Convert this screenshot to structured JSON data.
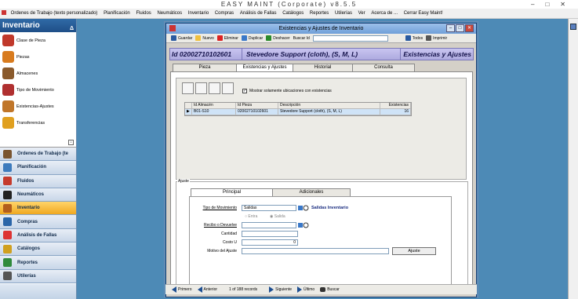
{
  "app": {
    "title": "EASY MAINT (Corporate) v8.5.5",
    "window_buttons": [
      "–",
      "□",
      "✕"
    ]
  },
  "menu": [
    "Ordenes de Trabajo (texto personalizado)",
    "Planificación",
    "Fluidos",
    "Neumáticos",
    "Inventario",
    "Compras",
    "Análisis de Fallas",
    "Catálogos",
    "Reportes",
    "Utilerías",
    "Ver",
    "Acerca de ...",
    "Cerrar Easy Maint!"
  ],
  "sidebar": {
    "title": "Inventario",
    "pin": "Δ",
    "items": [
      {
        "label": "Clase de Pieza",
        "icon": "pencil-icon",
        "color": "#c0392b"
      },
      {
        "label": "Piezas",
        "icon": "gear-icon",
        "color": "#d87b1e"
      },
      {
        "label": "Almacenes",
        "icon": "warehouse-icon",
        "color": "#8a5a2c"
      },
      {
        "label": "Tipo de Movimiento",
        "icon": "cards-icon",
        "color": "#b03030"
      },
      {
        "label": "Existencias-Ajustes",
        "icon": "boxes-icon",
        "color": "#c0762a"
      },
      {
        "label": "Transferencias",
        "icon": "transfer-icon",
        "color": "#e0a020"
      }
    ],
    "scroll_label": "↓",
    "nav": [
      {
        "label": "Ordenes de Trabajo (te",
        "icon": "clipboard-icon",
        "color": "#7a5530"
      },
      {
        "label": "Planificación",
        "icon": "calendar-icon",
        "color": "#3d7bbd"
      },
      {
        "label": "Fluidos",
        "icon": "fluid-icon",
        "color": "#c53a2c"
      },
      {
        "label": "Neumáticos",
        "icon": "tire-icon",
        "color": "#222"
      },
      {
        "label": "Inventario",
        "icon": "inventory-icon",
        "color": "#b35e1c",
        "active": true
      },
      {
        "label": "Compras",
        "icon": "cart-icon",
        "color": "#2a65a8"
      },
      {
        "label": "Análisis de Fallas",
        "icon": "warning-icon",
        "color": "#d33"
      },
      {
        "label": "Catálogos",
        "icon": "catalog-icon",
        "color": "#d0a020"
      },
      {
        "label": "Reportes",
        "icon": "report-icon",
        "color": "#2f8a3c"
      },
      {
        "label": "Utilerías",
        "icon": "tools-icon",
        "color": "#555"
      }
    ]
  },
  "window": {
    "title": "Existencias y Ajustes de Inventario",
    "toolbar": [
      {
        "label": "Guardar",
        "icon": "save-icon",
        "color": "#2a5aa0"
      },
      {
        "label": "Nuevo",
        "icon": "new-icon",
        "color": "#f0c040"
      },
      {
        "label": "Eliminar",
        "icon": "delete-icon",
        "color": "#d22"
      },
      {
        "label": "Duplicar",
        "icon": "duplicate-icon",
        "color": "#3a78c8"
      },
      {
        "label": "Deshacer",
        "icon": "undo-icon",
        "color": "#2a8a2a"
      },
      {
        "label": "Buscar Id",
        "icon": "",
        "color": ""
      }
    ],
    "toolbar_right": [
      {
        "label": "Todos",
        "icon": "list-icon",
        "color": "#2a5aa0"
      },
      {
        "label": "Imprimir",
        "icon": "print-icon",
        "color": "#555"
      }
    ],
    "header": {
      "id": "Id  02002710102601",
      "name": "Stevedore Support (cloth), (S, M, L)",
      "section": "Existencias y Ajustes"
    },
    "tabs": [
      {
        "label": "Pieza",
        "w": 82
      },
      {
        "label": "Existencias y Ajustes",
        "w": 73,
        "selected": true
      },
      {
        "label": "Historial",
        "w": 77
      },
      {
        "label": "Consulta",
        "w": 80
      }
    ],
    "filter_label": "Mostrar solamente ubicaciones con existencias",
    "filter_checked": "✓",
    "grid": {
      "headers": [
        "",
        "Id Almacén",
        "Id Pieza",
        "Descripción",
        "Existencias"
      ],
      "rows": [
        [
          "▶",
          "B01-S10",
          "02002710102601",
          "Stevedore Support (cloth), (S, M, L)",
          "16"
        ]
      ]
    },
    "ajuste": {
      "label": "Ajuste",
      "tabs": [
        "Principal",
        "Adicionales"
      ],
      "fields": {
        "tipo_label": "Tipo de Movimiento",
        "tipo_value": "Salidas",
        "tipo_desc": "Salidas Inventario",
        "radio_a": "Entra",
        "radio_b": "Salida",
        "recibo_label": "Recibo o Devuelve",
        "cantidad_label": "Cantidad",
        "costo_label": "Costo U",
        "costo_value": "0",
        "motivo_label": "Motivo del Ajuste",
        "button": "Ajuste"
      }
    },
    "nav": {
      "first": "Primero",
      "prev": "Anterior",
      "records": "1 of 188 records",
      "next": "Siguiente",
      "last": "Último",
      "search": "Buscar"
    }
  }
}
